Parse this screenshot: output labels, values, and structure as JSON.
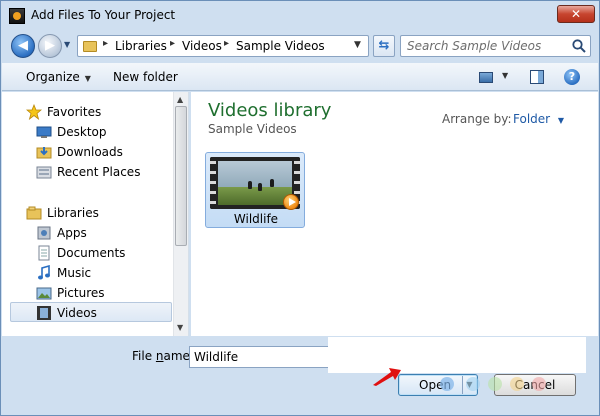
{
  "window": {
    "title": "Add Files To Your Project",
    "close_glyph": "✕"
  },
  "nav": {
    "back_glyph": "◀",
    "forward_glyph": "▶",
    "history_glyph": "▼",
    "breadcrumbs": [
      "Libraries",
      "Videos",
      "Sample Videos"
    ],
    "crumb_separator": "▸",
    "address_dropdown_glyph": "▼",
    "refresh_glyph": "⇆",
    "search_placeholder": "Search Sample Videos"
  },
  "toolbar": {
    "organize_label": "Organize",
    "new_folder_label": "New folder",
    "caret": "▼",
    "help_glyph": "?"
  },
  "sidebar": {
    "favorites": {
      "label": "Favorites",
      "icon": "star-icon"
    },
    "favorites_items": [
      {
        "label": "Desktop",
        "icon": "desktop-icon"
      },
      {
        "label": "Downloads",
        "icon": "downloads-icon"
      },
      {
        "label": "Recent Places",
        "icon": "recent-places-icon"
      }
    ],
    "libraries": {
      "label": "Libraries",
      "icon": "libraries-icon"
    },
    "libraries_items": [
      {
        "label": "Apps",
        "icon": "apps-icon"
      },
      {
        "label": "Documents",
        "icon": "documents-icon"
      },
      {
        "label": "Music",
        "icon": "music-icon"
      },
      {
        "label": "Pictures",
        "icon": "pictures-icon"
      },
      {
        "label": "Videos",
        "icon": "videos-icon",
        "selected": true
      }
    ],
    "scroll_up_glyph": "▲",
    "scroll_down_glyph": "▼"
  },
  "content": {
    "library_title": "Videos library",
    "library_subtitle": "Sample Videos",
    "arrange_label": "Arrange by:",
    "arrange_value": "Folder",
    "arrange_caret": "▼",
    "files": [
      {
        "name": "Wildlife",
        "type": "video"
      }
    ]
  },
  "footer": {
    "filename_label_pre": "File ",
    "filename_label_ul": "n",
    "filename_label_post": "ame:",
    "filename_value": "Wildlife",
    "open_label": "Open",
    "open_split_glyph": "▼",
    "cancel_label": "Cancel"
  },
  "colors": {
    "library_title": "#1f6f2f",
    "link_blue": "#1f5aa6",
    "annotation_arrow": "#e01010"
  }
}
